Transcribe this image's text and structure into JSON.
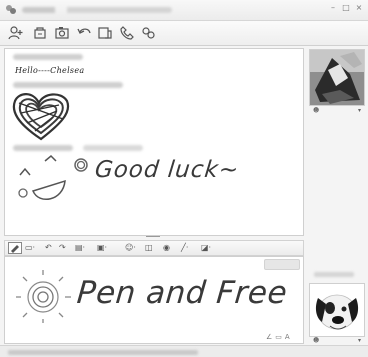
{
  "chat": {
    "drawn_greeting": "Hello----Chelsea",
    "handwritten_message": "Good luck~"
  },
  "input": {
    "handwritten_text": "Pen and Free"
  },
  "icons": {
    "app": "messenger-app-icon",
    "toolbar": [
      "invite-icon",
      "file-share-icon",
      "photo-icon",
      "undo-icon",
      "block-icon",
      "phone-icon",
      "profile-icon"
    ],
    "format": [
      "pen-mode-icon",
      "font-icon",
      "emoticon-icon",
      "nudge-icon",
      "background-icon",
      "ink-color-icon"
    ]
  },
  "colors": {
    "ink": "#3a3a3a",
    "frame": "#cfcfcf"
  }
}
